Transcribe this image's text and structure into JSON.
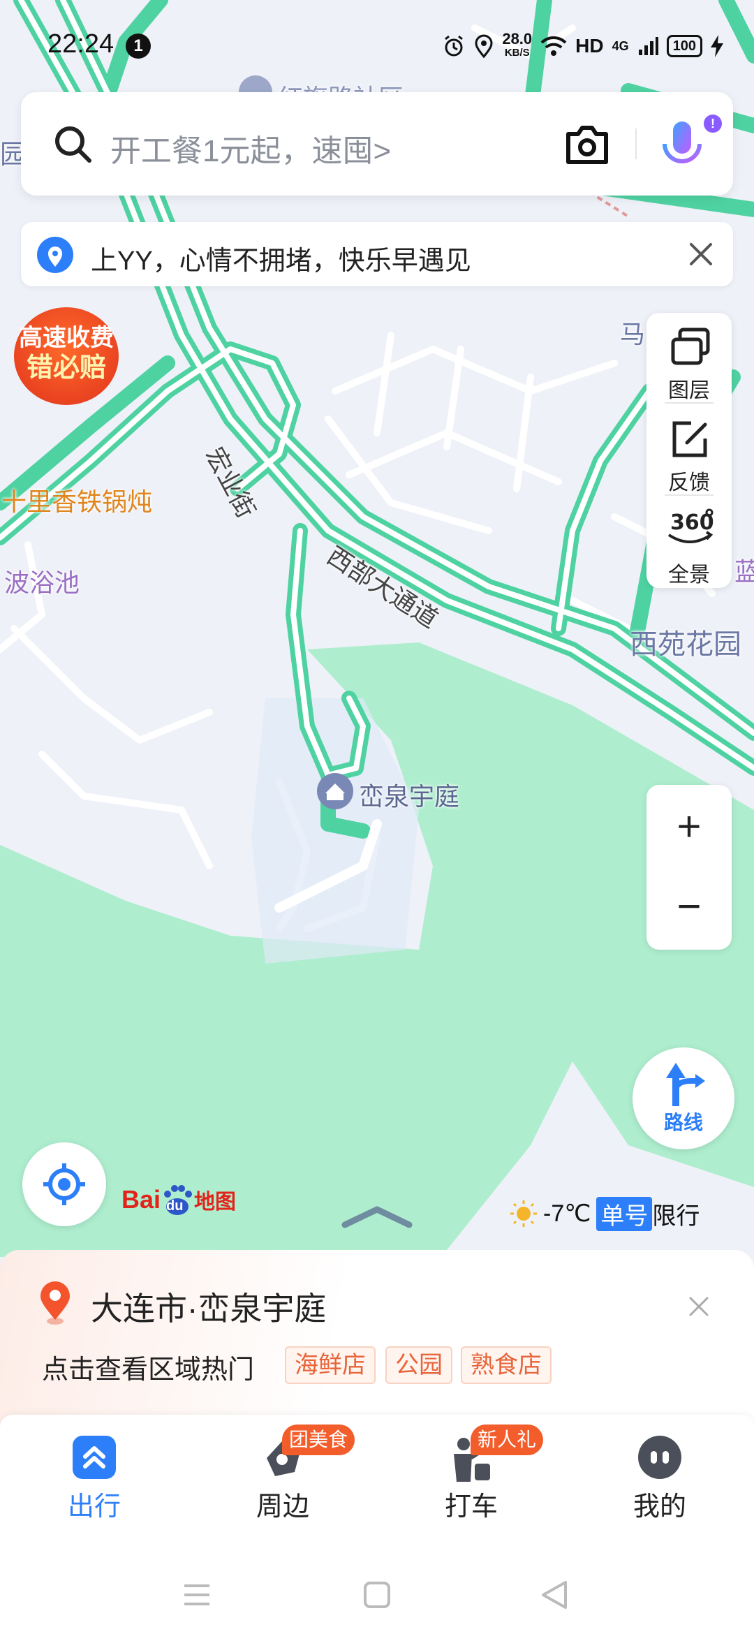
{
  "status_bar": {
    "time": "22:24",
    "notification_count": "1",
    "net_speed": "28.0",
    "net_speed_unit": "KB/S",
    "hd": "HD",
    "network": "4G",
    "battery": "100"
  },
  "search": {
    "placeholder": "开工餐1元起，速囤>"
  },
  "notice": {
    "text": "上YY，心情不拥堵，快乐早遇见"
  },
  "promo_badge": {
    "line1": "高速收费",
    "line2": "错必赔"
  },
  "map_labels": {
    "top_road": "红旗路社区",
    "top_left_edge": "园",
    "street_hongye": "宏业街",
    "street_xibu": "西部大通道",
    "poi_restaurant": "十里香铁锅炖",
    "poi_bath": "波浴池",
    "poi_xiyuan": "西苑花园",
    "poi_ma": "马",
    "poi_lan": "蓝",
    "poi_main": "峦泉宇庭"
  },
  "side_tools": [
    {
      "label": "图层"
    },
    {
      "label": "反馈"
    },
    {
      "label": "全景"
    }
  ],
  "zoom": {
    "in": "+",
    "out": "−"
  },
  "route": {
    "label": "路线"
  },
  "logo": {
    "bai": "Bai",
    "du": "du",
    "map": "地图"
  },
  "weather": {
    "temp": "-7℃",
    "restriction_tag": "单号",
    "restriction_text": "限行"
  },
  "location_card": {
    "place": "大连市·峦泉宇庭",
    "hint": "点击查看区域热门",
    "tags": [
      "海鲜店",
      "公园",
      "熟食店"
    ]
  },
  "tabs": [
    {
      "label": "出行",
      "badge": ""
    },
    {
      "label": "周边",
      "badge": "团美食"
    },
    {
      "label": "打车",
      "badge": "新人礼"
    },
    {
      "label": "我的",
      "badge": ""
    }
  ],
  "colors": {
    "road": "#4fd2a2",
    "park": "#aeeecf",
    "accent": "#2d7ff9",
    "active_tab": "#2d7ff9",
    "badge": "#f35c2b"
  }
}
